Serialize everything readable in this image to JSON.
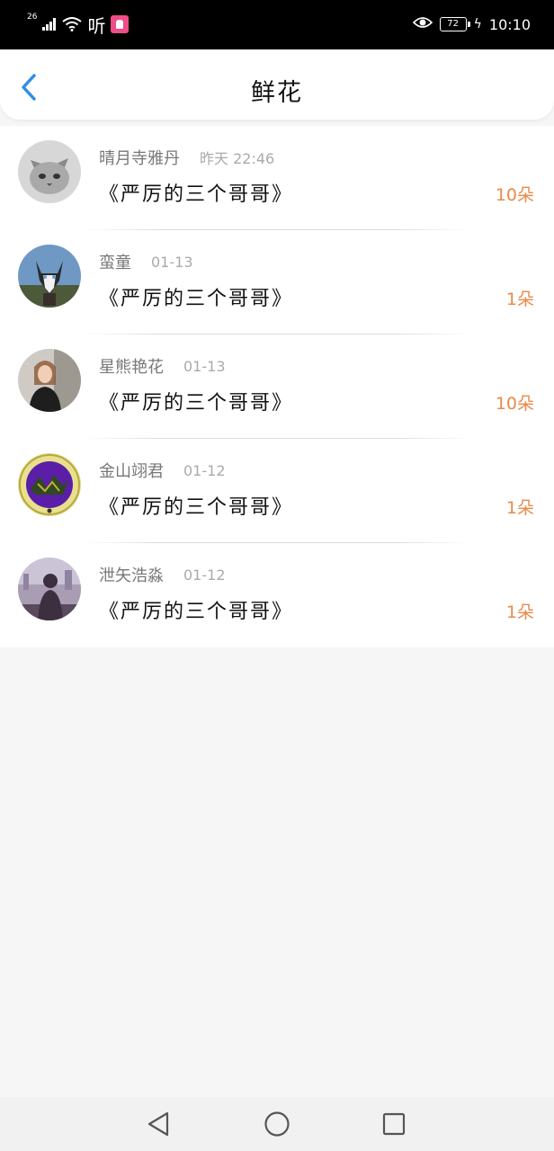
{
  "status_bar": {
    "network": "26",
    "app_glyph": "听",
    "battery": "72",
    "time": "10:10"
  },
  "header": {
    "title": "鲜花",
    "back_icon": "chevron-left-icon"
  },
  "items": [
    {
      "name": "晴月寺雅丹",
      "time": "昨天 22:46",
      "book": "《严厉的三个哥哥》",
      "count": "10朵",
      "avatar": "cat"
    },
    {
      "name": "蛮童",
      "time": "01-13",
      "book": "《严厉的三个哥哥》",
      "count": "1朵",
      "avatar": "husky"
    },
    {
      "name": "星熊艳花",
      "time": "01-13",
      "book": "《严厉的三个哥哥》",
      "count": "10朵",
      "avatar": "woman"
    },
    {
      "name": "金山翊君",
      "time": "01-12",
      "book": "《严厉的三个哥哥》",
      "count": "1朵",
      "avatar": "emblem"
    },
    {
      "name": "泄矢浩淼",
      "time": "01-12",
      "book": "《严厉的三个哥哥》",
      "count": "1朵",
      "avatar": "city"
    }
  ],
  "colors": {
    "accent": "#2f8fe6",
    "count": "#e98a4a"
  }
}
